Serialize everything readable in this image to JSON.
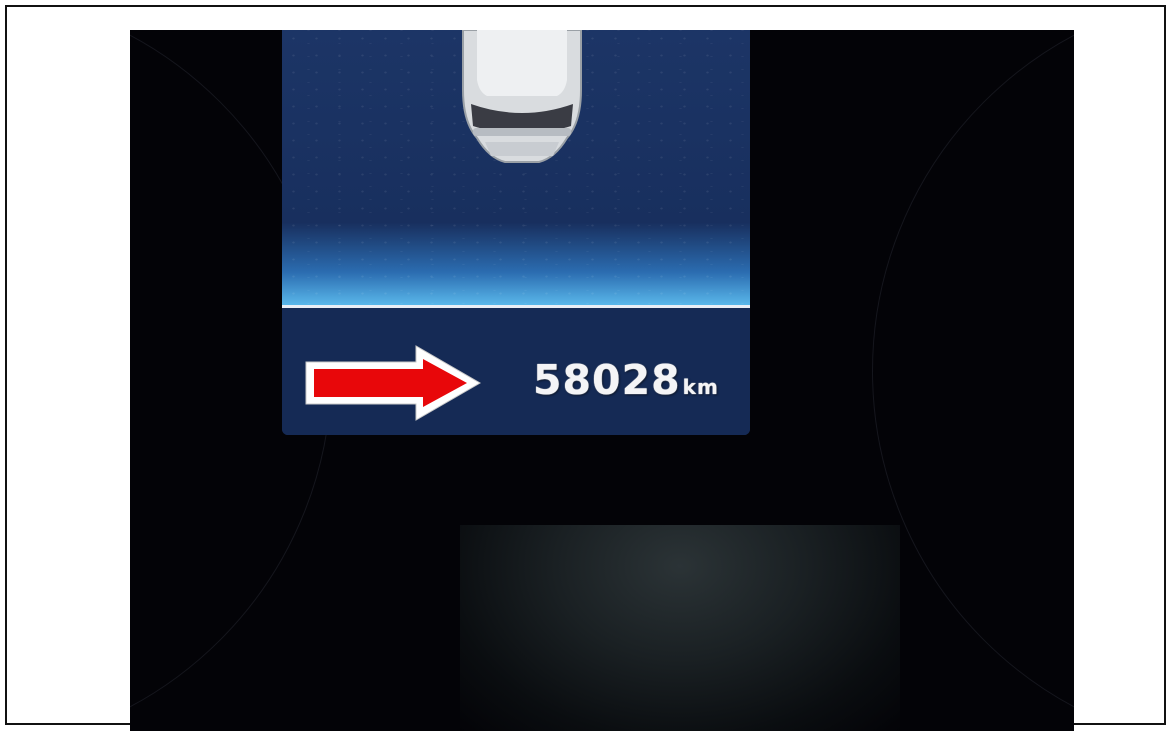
{
  "odometer": {
    "value": "58028",
    "unit": "km"
  },
  "annotation": {
    "arrow_color": "#e8070a",
    "arrow_outline_color": "#ffffff"
  },
  "display": {
    "background_color": "#172c58",
    "accent_color": "#59b7ea"
  }
}
